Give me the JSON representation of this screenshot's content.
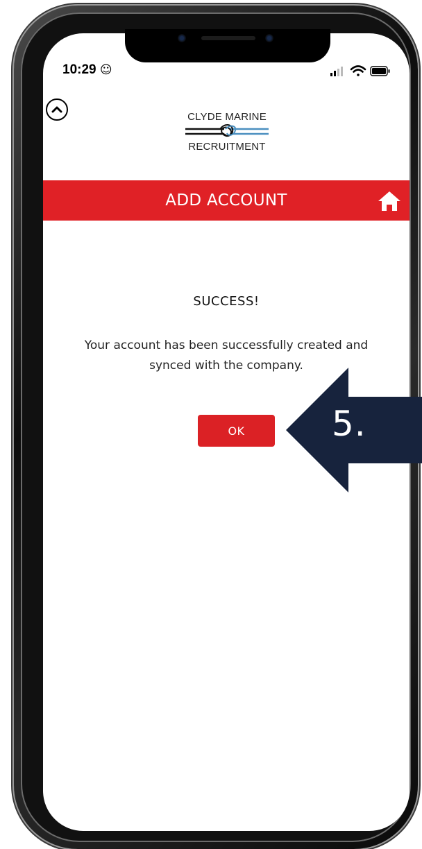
{
  "status_bar": {
    "time": "10:29",
    "time_emoji": "☺",
    "signal_icon": "cellular-signal-icon",
    "wifi_icon": "wifi-icon",
    "battery_icon": "battery-icon"
  },
  "logo": {
    "top_text": "CLYDE MARINE",
    "bottom_text": "RECRUITMENT",
    "mark_icon": "rope-knot-icon"
  },
  "header": {
    "title": "ADD ACCOUNT",
    "home_icon": "home-icon",
    "background_color": "#e02126"
  },
  "content": {
    "title": "SUCCESS!",
    "message_line1": "Your account has been successfully created and",
    "message_line2": "synced with the company.",
    "ok_label": "OK",
    "ok_color": "#db2125"
  },
  "callout": {
    "label": "5.",
    "color": "#17233d"
  },
  "collapse_icon": "chevron-up-icon"
}
